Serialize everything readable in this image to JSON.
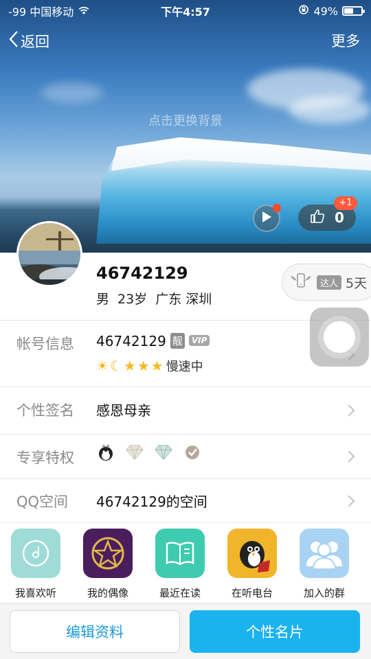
{
  "status_bar": {
    "carrier": "-99 中国移动",
    "time": "下午4:57",
    "battery_text": "49%",
    "battery_level": 0.49
  },
  "nav": {
    "back_label": "返回",
    "more_label": "更多"
  },
  "cover": {
    "change_bg_text": "点击更换背景",
    "like_count": "0",
    "like_badge": "+1"
  },
  "profile": {
    "nickname": "46742129",
    "gender": "男",
    "age": "23岁",
    "province": "广东",
    "city": "深圳",
    "daren_tag": "达人",
    "daren_days": "5天"
  },
  "rows": {
    "account": {
      "label": "帐号信息",
      "value": "46742129",
      "liang_tag": "靓",
      "vip_tag": "VIP",
      "speed_text": "慢速中"
    },
    "signature": {
      "label": "个性签名",
      "value": "感恩母亲"
    },
    "privileges": {
      "label": "专享特权"
    },
    "qzone": {
      "label": "QQ空间",
      "value": "46742129的空间"
    }
  },
  "apps": [
    {
      "label": "我喜欢听",
      "icon": "music-disc-icon",
      "color": "#9fdcd7"
    },
    {
      "label": "我的偶像",
      "icon": "star-idol-icon",
      "color": "#4a1e5c"
    },
    {
      "label": "最近在读",
      "icon": "open-book-icon",
      "color": "#3fcbb0"
    },
    {
      "label": "在听电台",
      "icon": "penguin-radio-icon",
      "color": "#f0b52a"
    },
    {
      "label": "加入的群",
      "icon": "group-people-icon",
      "color": "#a9d3f2"
    }
  ],
  "bottom": {
    "edit_label": "编辑资料",
    "card_label": "个性名片"
  },
  "colors": {
    "accent": "#1ab3ef",
    "accent_text": "#1d9bd6",
    "badge_red": "#ff5a3b"
  }
}
